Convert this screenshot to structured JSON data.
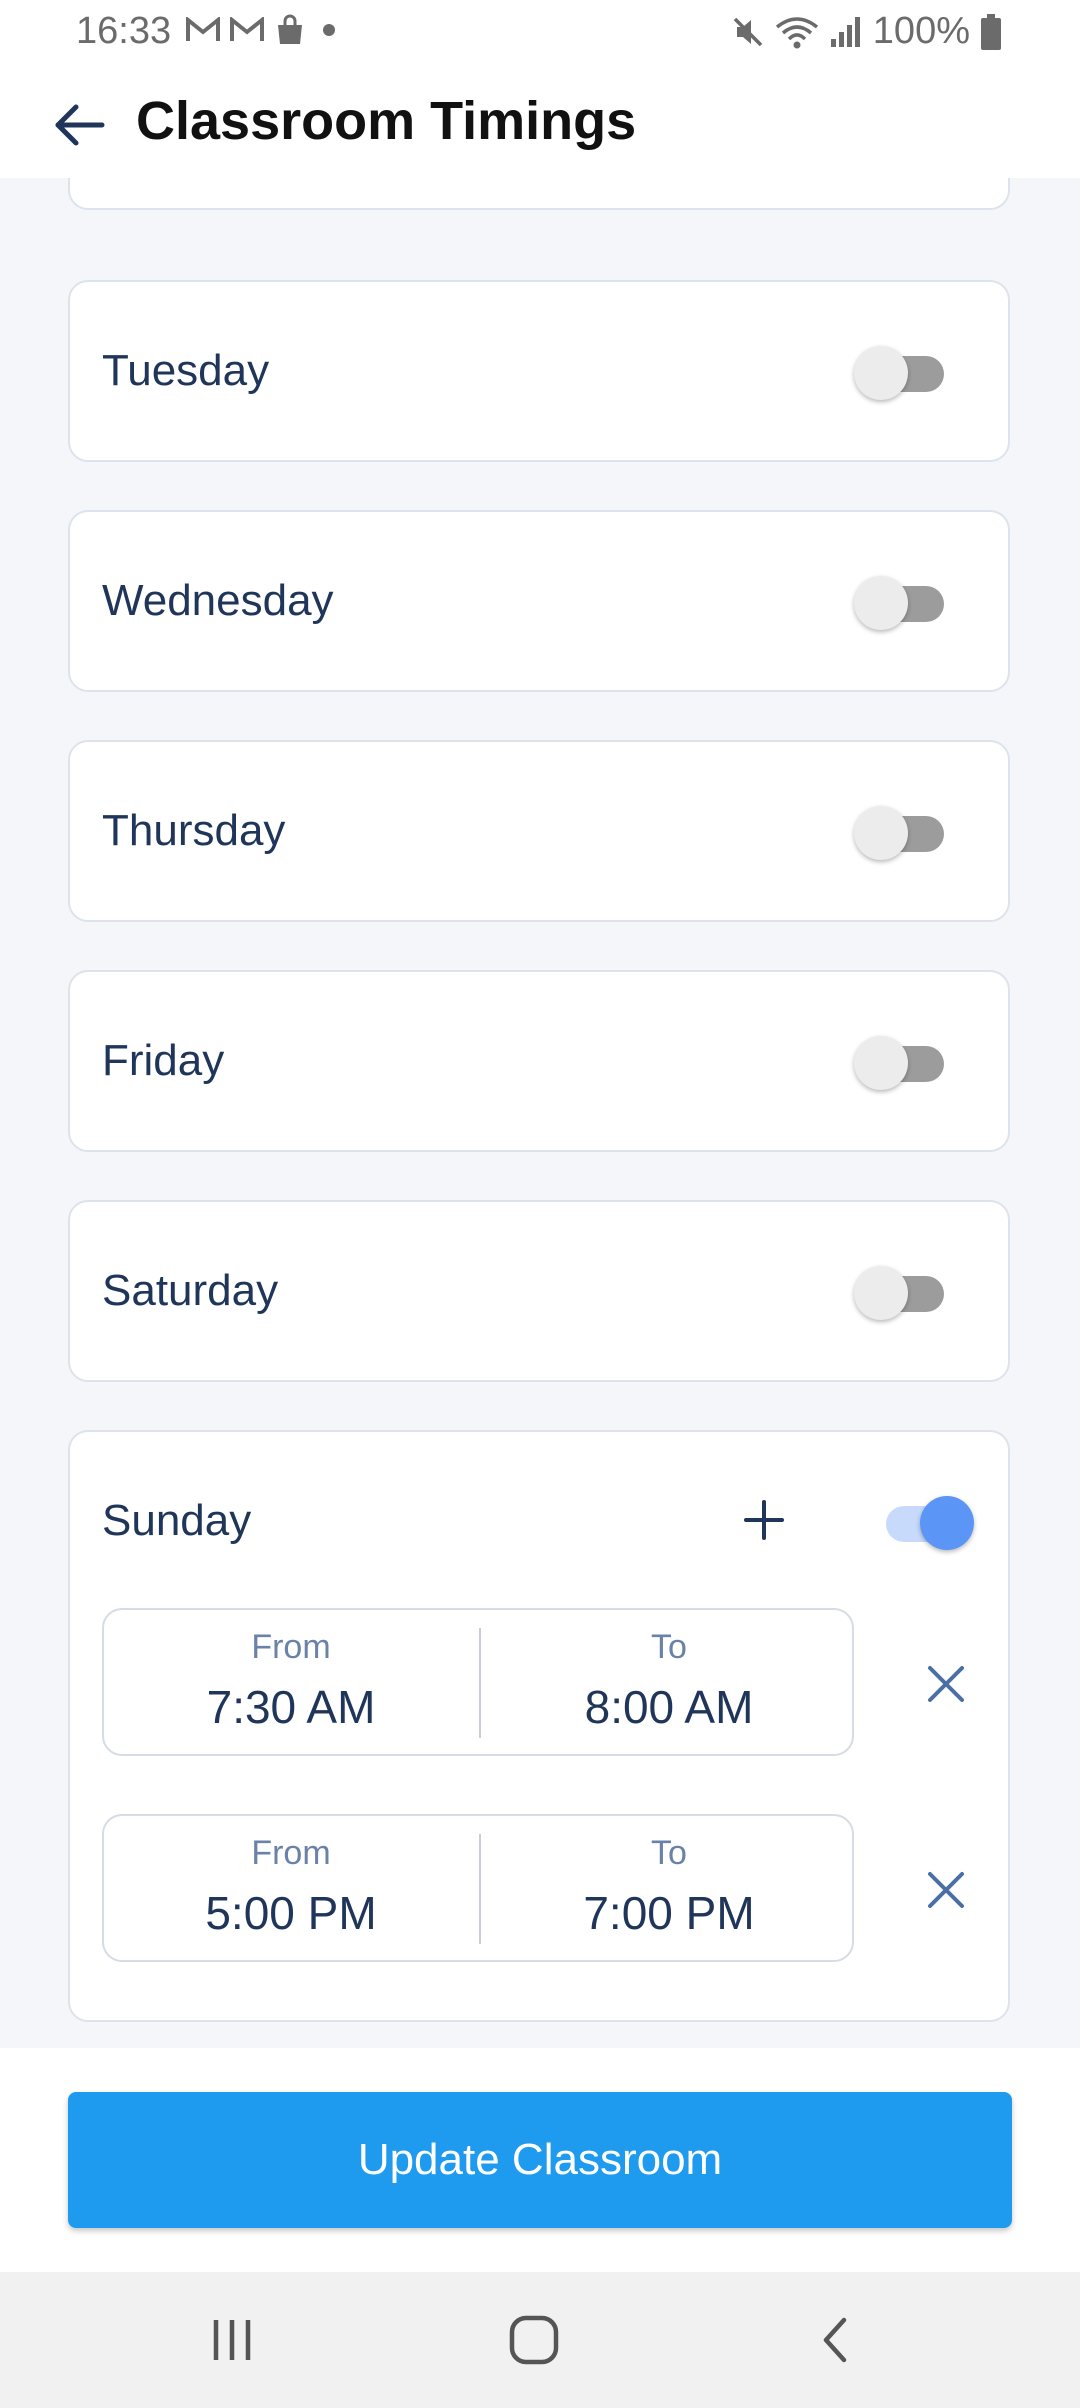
{
  "status_bar": {
    "time": "16:33",
    "battery": "100%",
    "left_icons": [
      "gmail-icon",
      "gmail-icon",
      "shopping-bag-icon",
      "dot-icon"
    ],
    "right_icons": [
      "mute-icon",
      "wifi-icon",
      "signal-icon",
      "battery-icon"
    ]
  },
  "app_bar": {
    "title": "Classroom Timings",
    "back_icon": "back-arrow-icon"
  },
  "days": [
    {
      "label": "Tuesday",
      "enabled": false
    },
    {
      "label": "Wednesday",
      "enabled": false
    },
    {
      "label": "Thursday",
      "enabled": false
    },
    {
      "label": "Friday",
      "enabled": false
    },
    {
      "label": "Saturday",
      "enabled": false
    },
    {
      "label": "Sunday",
      "enabled": true,
      "slots": [
        {
          "from_label": "From",
          "from": "7:30 AM",
          "to_label": "To",
          "to": "8:00 AM"
        },
        {
          "from_label": "From",
          "from": "5:00 PM",
          "to_label": "To",
          "to": "7:00 PM"
        }
      ]
    }
  ],
  "update_button": {
    "label": "Update Classroom"
  },
  "colors": {
    "accent": "#1e9bef",
    "text_primary": "#1f3559",
    "toggle_on": "#5b95f5",
    "toggle_off": "#9c9c9c"
  },
  "nav": {
    "icons": [
      "recent-apps-icon",
      "home-icon",
      "back-icon"
    ]
  }
}
